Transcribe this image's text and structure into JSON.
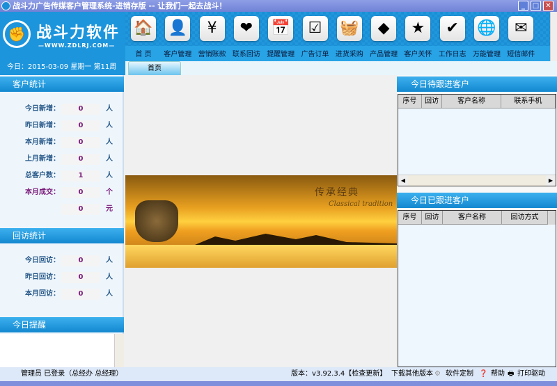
{
  "window": {
    "title": "战斗力广告传媒客户管理系统-进销存版  --  让我们一起去战斗！"
  },
  "logo": {
    "name": "战斗力软件",
    "url": "—WWW.ZDLRJ.COM—"
  },
  "date_line": "今日：2015-03-09  星期一  第11周",
  "toolbar": [
    {
      "label": "首 页",
      "icon": "home-icon",
      "glyph": "🏠"
    },
    {
      "label": "客户管理",
      "icon": "customer-icon",
      "glyph": "👤"
    },
    {
      "label": "营销账款",
      "icon": "yen-icon",
      "glyph": "¥"
    },
    {
      "label": "联系回访",
      "icon": "heart-icon",
      "glyph": "❤"
    },
    {
      "label": "提醒管理",
      "icon": "calendar-icon",
      "glyph": "📅"
    },
    {
      "label": "广告订单",
      "icon": "checkbox-icon",
      "glyph": "☑"
    },
    {
      "label": "进货采购",
      "icon": "basket-icon",
      "glyph": "🧺"
    },
    {
      "label": "产品管理",
      "icon": "product-icon",
      "glyph": "◆"
    },
    {
      "label": "客户关怀",
      "icon": "medal-icon",
      "glyph": "★"
    },
    {
      "label": "工作日志",
      "icon": "log-icon",
      "glyph": "✔"
    },
    {
      "label": "万能管理",
      "icon": "globe-icon",
      "glyph": "🌐"
    },
    {
      "label": "短信邮件",
      "icon": "mail-icon",
      "glyph": "✉"
    }
  ],
  "tabs": [
    {
      "label": "首页"
    }
  ],
  "customer_stats": {
    "title": "客户统计",
    "rows": [
      {
        "label": "今日新增：",
        "value": "0",
        "unit": "人"
      },
      {
        "label": "昨日新增：",
        "value": "0",
        "unit": "人"
      },
      {
        "label": "本月新增：",
        "value": "0",
        "unit": "人"
      },
      {
        "label": "上月新增：",
        "value": "0",
        "unit": "人"
      },
      {
        "label": "总客户数：",
        "value": "1",
        "unit": "人"
      },
      {
        "label": "本月成交：",
        "value": "0",
        "unit": "个"
      },
      {
        "label": "",
        "value": "0",
        "unit": "元"
      }
    ]
  },
  "visit_stats": {
    "title": "回访统计",
    "rows": [
      {
        "label": "今日回访：",
        "value": "0",
        "unit": "人"
      },
      {
        "label": "昨日回访：",
        "value": "0",
        "unit": "人"
      },
      {
        "label": "本月回访：",
        "value": "0",
        "unit": "人"
      }
    ]
  },
  "reminder": {
    "title": "今日提醒"
  },
  "banner": {
    "title": "传承经典",
    "subtitle": "Classical tradition"
  },
  "pending": {
    "title": "今日待跟进客户",
    "columns": [
      "序号",
      "回访",
      "客户名称",
      "联系手机"
    ]
  },
  "followed": {
    "title": "今日已跟进客户",
    "columns": [
      "序号",
      "回访",
      "客户名称",
      "回访方式"
    ]
  },
  "status": {
    "user": "管理员 已登录（总经办 总经理）",
    "version": "版本：v3.92.3.4【检查更新】",
    "download": "下载其他版本",
    "custom": "软件定制",
    "help": "帮助",
    "print": "打印驱动"
  }
}
